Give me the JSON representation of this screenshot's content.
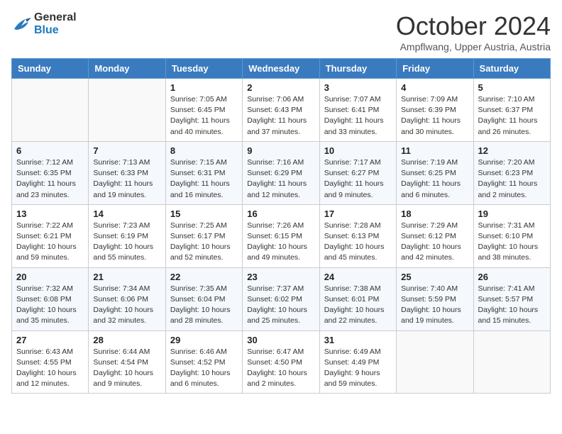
{
  "header": {
    "logo_general": "General",
    "logo_blue": "Blue",
    "month": "October 2024",
    "location": "Ampflwang, Upper Austria, Austria"
  },
  "days_of_week": [
    "Sunday",
    "Monday",
    "Tuesday",
    "Wednesday",
    "Thursday",
    "Friday",
    "Saturday"
  ],
  "weeks": [
    [
      {
        "day": "",
        "info": ""
      },
      {
        "day": "",
        "info": ""
      },
      {
        "day": "1",
        "info": "Sunrise: 7:05 AM\nSunset: 6:45 PM\nDaylight: 11 hours\nand 40 minutes."
      },
      {
        "day": "2",
        "info": "Sunrise: 7:06 AM\nSunset: 6:43 PM\nDaylight: 11 hours\nand 37 minutes."
      },
      {
        "day": "3",
        "info": "Sunrise: 7:07 AM\nSunset: 6:41 PM\nDaylight: 11 hours\nand 33 minutes."
      },
      {
        "day": "4",
        "info": "Sunrise: 7:09 AM\nSunset: 6:39 PM\nDaylight: 11 hours\nand 30 minutes."
      },
      {
        "day": "5",
        "info": "Sunrise: 7:10 AM\nSunset: 6:37 PM\nDaylight: 11 hours\nand 26 minutes."
      }
    ],
    [
      {
        "day": "6",
        "info": "Sunrise: 7:12 AM\nSunset: 6:35 PM\nDaylight: 11 hours\nand 23 minutes."
      },
      {
        "day": "7",
        "info": "Sunrise: 7:13 AM\nSunset: 6:33 PM\nDaylight: 11 hours\nand 19 minutes."
      },
      {
        "day": "8",
        "info": "Sunrise: 7:15 AM\nSunset: 6:31 PM\nDaylight: 11 hours\nand 16 minutes."
      },
      {
        "day": "9",
        "info": "Sunrise: 7:16 AM\nSunset: 6:29 PM\nDaylight: 11 hours\nand 12 minutes."
      },
      {
        "day": "10",
        "info": "Sunrise: 7:17 AM\nSunset: 6:27 PM\nDaylight: 11 hours\nand 9 minutes."
      },
      {
        "day": "11",
        "info": "Sunrise: 7:19 AM\nSunset: 6:25 PM\nDaylight: 11 hours\nand 6 minutes."
      },
      {
        "day": "12",
        "info": "Sunrise: 7:20 AM\nSunset: 6:23 PM\nDaylight: 11 hours\nand 2 minutes."
      }
    ],
    [
      {
        "day": "13",
        "info": "Sunrise: 7:22 AM\nSunset: 6:21 PM\nDaylight: 10 hours\nand 59 minutes."
      },
      {
        "day": "14",
        "info": "Sunrise: 7:23 AM\nSunset: 6:19 PM\nDaylight: 10 hours\nand 55 minutes."
      },
      {
        "day": "15",
        "info": "Sunrise: 7:25 AM\nSunset: 6:17 PM\nDaylight: 10 hours\nand 52 minutes."
      },
      {
        "day": "16",
        "info": "Sunrise: 7:26 AM\nSunset: 6:15 PM\nDaylight: 10 hours\nand 49 minutes."
      },
      {
        "day": "17",
        "info": "Sunrise: 7:28 AM\nSunset: 6:13 PM\nDaylight: 10 hours\nand 45 minutes."
      },
      {
        "day": "18",
        "info": "Sunrise: 7:29 AM\nSunset: 6:12 PM\nDaylight: 10 hours\nand 42 minutes."
      },
      {
        "day": "19",
        "info": "Sunrise: 7:31 AM\nSunset: 6:10 PM\nDaylight: 10 hours\nand 38 minutes."
      }
    ],
    [
      {
        "day": "20",
        "info": "Sunrise: 7:32 AM\nSunset: 6:08 PM\nDaylight: 10 hours\nand 35 minutes."
      },
      {
        "day": "21",
        "info": "Sunrise: 7:34 AM\nSunset: 6:06 PM\nDaylight: 10 hours\nand 32 minutes."
      },
      {
        "day": "22",
        "info": "Sunrise: 7:35 AM\nSunset: 6:04 PM\nDaylight: 10 hours\nand 28 minutes."
      },
      {
        "day": "23",
        "info": "Sunrise: 7:37 AM\nSunset: 6:02 PM\nDaylight: 10 hours\nand 25 minutes."
      },
      {
        "day": "24",
        "info": "Sunrise: 7:38 AM\nSunset: 6:01 PM\nDaylight: 10 hours\nand 22 minutes."
      },
      {
        "day": "25",
        "info": "Sunrise: 7:40 AM\nSunset: 5:59 PM\nDaylight: 10 hours\nand 19 minutes."
      },
      {
        "day": "26",
        "info": "Sunrise: 7:41 AM\nSunset: 5:57 PM\nDaylight: 10 hours\nand 15 minutes."
      }
    ],
    [
      {
        "day": "27",
        "info": "Sunrise: 6:43 AM\nSunset: 4:55 PM\nDaylight: 10 hours\nand 12 minutes."
      },
      {
        "day": "28",
        "info": "Sunrise: 6:44 AM\nSunset: 4:54 PM\nDaylight: 10 hours\nand 9 minutes."
      },
      {
        "day": "29",
        "info": "Sunrise: 6:46 AM\nSunset: 4:52 PM\nDaylight: 10 hours\nand 6 minutes."
      },
      {
        "day": "30",
        "info": "Sunrise: 6:47 AM\nSunset: 4:50 PM\nDaylight: 10 hours\nand 2 minutes."
      },
      {
        "day": "31",
        "info": "Sunrise: 6:49 AM\nSunset: 4:49 PM\nDaylight: 9 hours\nand 59 minutes."
      },
      {
        "day": "",
        "info": ""
      },
      {
        "day": "",
        "info": ""
      }
    ]
  ]
}
